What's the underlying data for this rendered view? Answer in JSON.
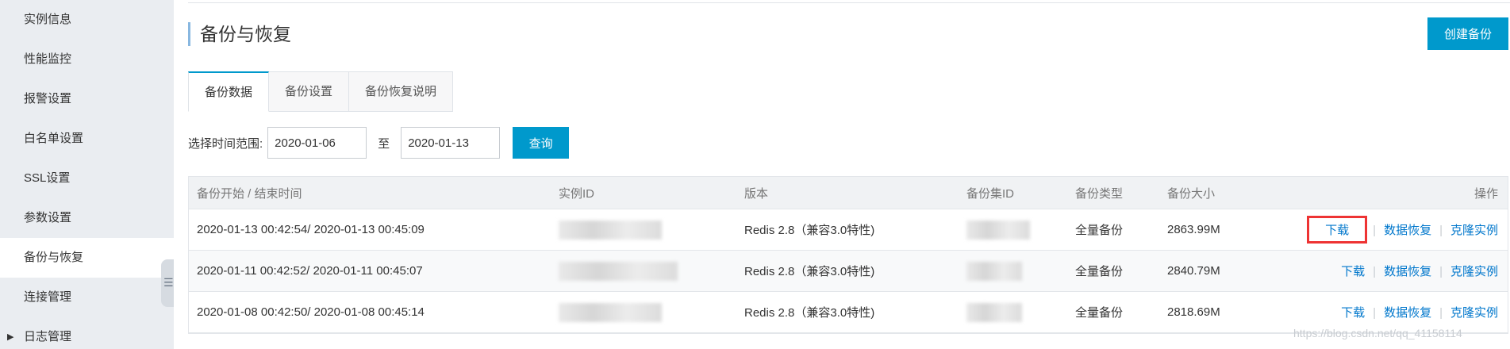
{
  "sidebar": {
    "items": [
      {
        "label": "实例信息"
      },
      {
        "label": "性能监控"
      },
      {
        "label": "报警设置"
      },
      {
        "label": "白名单设置"
      },
      {
        "label": "SSL设置"
      },
      {
        "label": "参数设置"
      },
      {
        "label": "备份与恢复",
        "active": true
      },
      {
        "label": "连接管理"
      },
      {
        "label": "日志管理"
      }
    ],
    "collapse_icon": "collapse-handle-icon"
  },
  "page": {
    "title": "备份与恢复",
    "create_button": "创建备份"
  },
  "tabs": [
    {
      "label": "备份数据",
      "active": true
    },
    {
      "label": "备份设置"
    },
    {
      "label": "备份恢复说明"
    }
  ],
  "filter": {
    "label": "选择时间范围:",
    "start": "2020-01-06",
    "separator": "至",
    "end": "2020-01-13",
    "query_button": "查询"
  },
  "table": {
    "headers": [
      "备份开始 / 结束时间",
      "实例ID",
      "版本",
      "备份集ID",
      "备份类型",
      "备份大小",
      "操作"
    ],
    "rows": [
      {
        "time": "2020-01-13 00:42:54/ 2020-01-13 00:45:09",
        "version": "Redis 2.8（兼容3.0特性)",
        "type": "全量备份",
        "size": "2863.99M"
      },
      {
        "time": "2020-01-11 00:42:52/ 2020-01-11 00:45:07",
        "version": "Redis 2.8（兼容3.0特性)",
        "type": "全量备份",
        "size": "2840.79M"
      },
      {
        "time": "2020-01-08 00:42:50/ 2020-01-08 00:45:14",
        "version": "Redis 2.8（兼容3.0特性)",
        "type": "全量备份",
        "size": "2818.69M"
      }
    ],
    "ops": {
      "download": "下载",
      "restore": "数据恢复",
      "clone": "克隆实例",
      "sep": "|"
    }
  },
  "watermark": "https://blog.csdn.net/qq_41158114",
  "colors": {
    "accent": "#0099cc",
    "link": "#0077cc",
    "highlight": "#ee3333"
  }
}
